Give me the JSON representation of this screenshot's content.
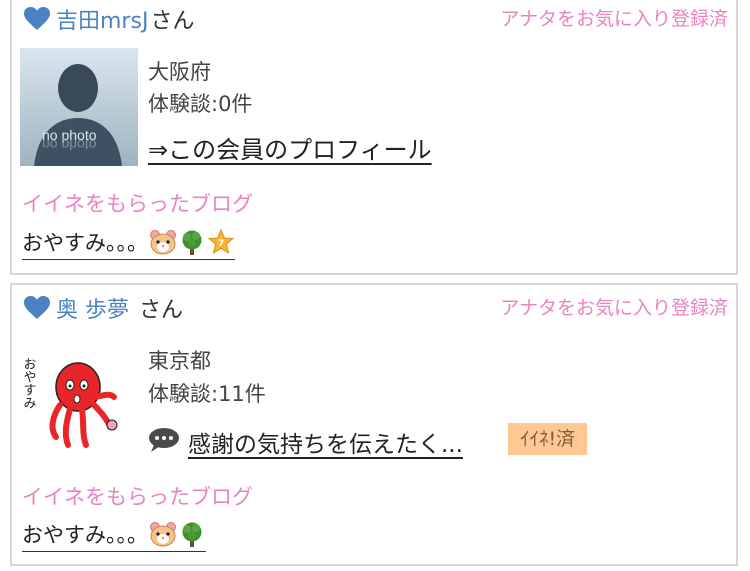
{
  "members": [
    {
      "name": "吉田mrsJ",
      "suffix": "さん",
      "favorite_status": "アナタをお気に入り登録済",
      "avatar_text": "no photo",
      "prefecture": "大阪府",
      "experiences": "体験談:0件",
      "profile_link": "⇒この会員のプロフィール",
      "liked_blog_heading": "イイネをもらったブログ",
      "blog_title": "おやすみ。。。",
      "blog_emojis": [
        "hamster-icon",
        "tree-icon",
        "star-7-badge-icon"
      ]
    },
    {
      "name": "奥 歩夢",
      "suffix": "さん",
      "favorite_status": "アナタをお気に入り登録済",
      "avatar_text": "おやすみ",
      "prefecture": "東京都",
      "experiences": "体験談:11件",
      "message_link": "感謝の気持ちを伝えたく...",
      "iine_badge": "ｲｲﾈ!済",
      "liked_blog_heading": "イイネをもらったブログ",
      "blog_title": "おやすみ。。。",
      "blog_emojis": [
        "hamster-icon",
        "tree-icon"
      ]
    }
  ],
  "colors": {
    "name": "#4a82c4",
    "pink": "#e884c4",
    "badge": "#ffc892",
    "border": "#d6d6d6"
  }
}
